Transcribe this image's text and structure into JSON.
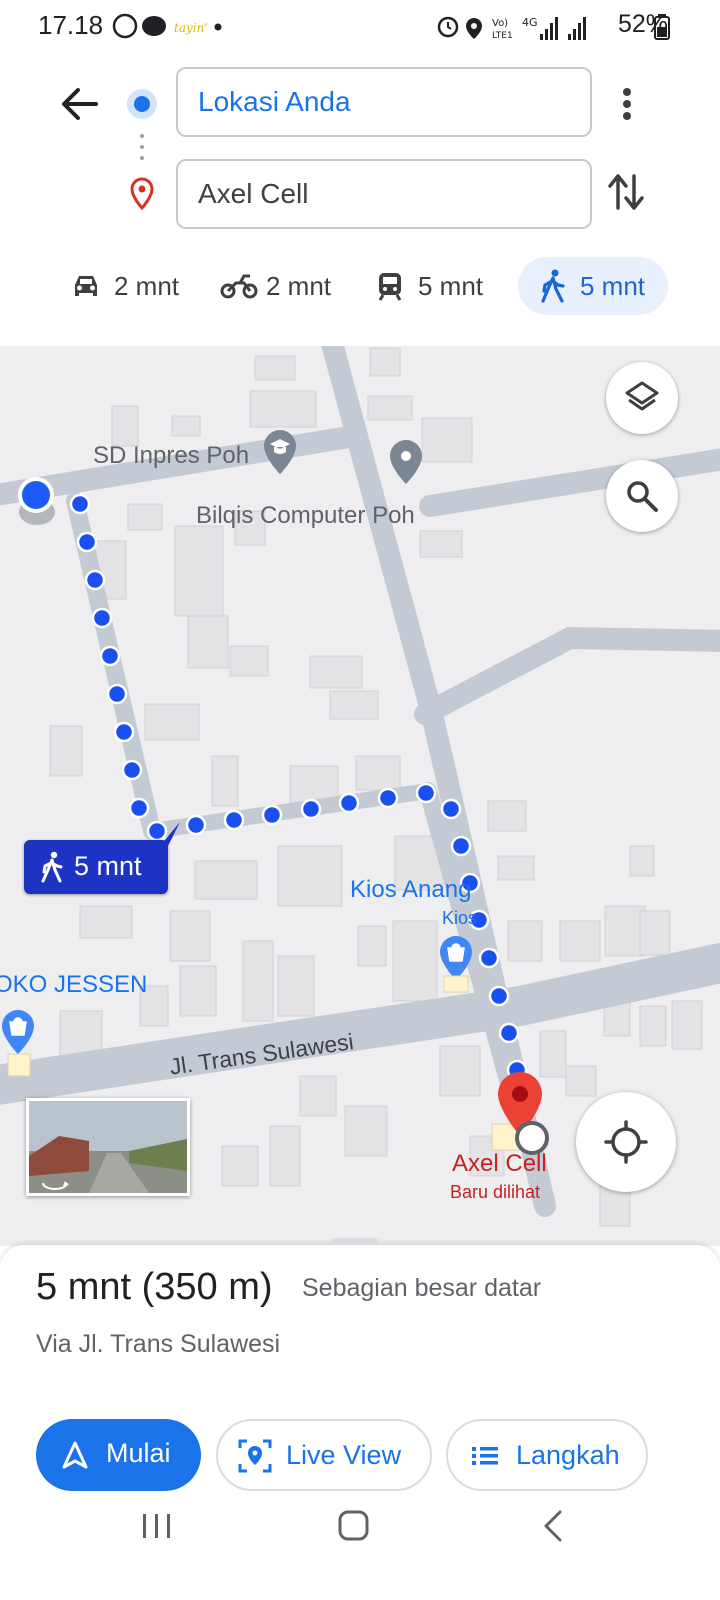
{
  "status_bar": {
    "time": "17.18",
    "network_label": "Vo) 4G LTE1",
    "battery": "52%"
  },
  "directions": {
    "origin": "Lokasi Anda",
    "destination": "Axel Cell"
  },
  "travel_modes": [
    {
      "mode": "car",
      "label": "2 mnt"
    },
    {
      "mode": "motorcycle",
      "label": "2 mnt"
    },
    {
      "mode": "transit",
      "label": "5 mnt"
    },
    {
      "mode": "walk",
      "label": "5 mnt",
      "selected": true
    }
  ],
  "map": {
    "labels": {
      "school": "SD Inpres Poh",
      "computer_shop": "Bilqis Computer Poh",
      "kios_name": "Kios Anang",
      "kios_category": "Kios",
      "toko": "OKO JESSEN",
      "street": "Jl. Trans Sulawesi",
      "destination_name": "Axel Cell",
      "destination_note": "Baru dilihat"
    },
    "route_badge": "5 mnt"
  },
  "summary": {
    "duration": "5 mnt",
    "distance": "(350 m)",
    "terrain": "Sebagian besar datar",
    "via": "Via Jl. Trans Sulawesi"
  },
  "actions": {
    "start": "Mulai",
    "live_view": "Live View",
    "steps": "Langkah"
  },
  "colors": {
    "accent": "#1a73e8",
    "route_dot": "#1a4ff0",
    "destination_pin": "#ea4335",
    "route_badge_bg": "#1d33c4"
  }
}
